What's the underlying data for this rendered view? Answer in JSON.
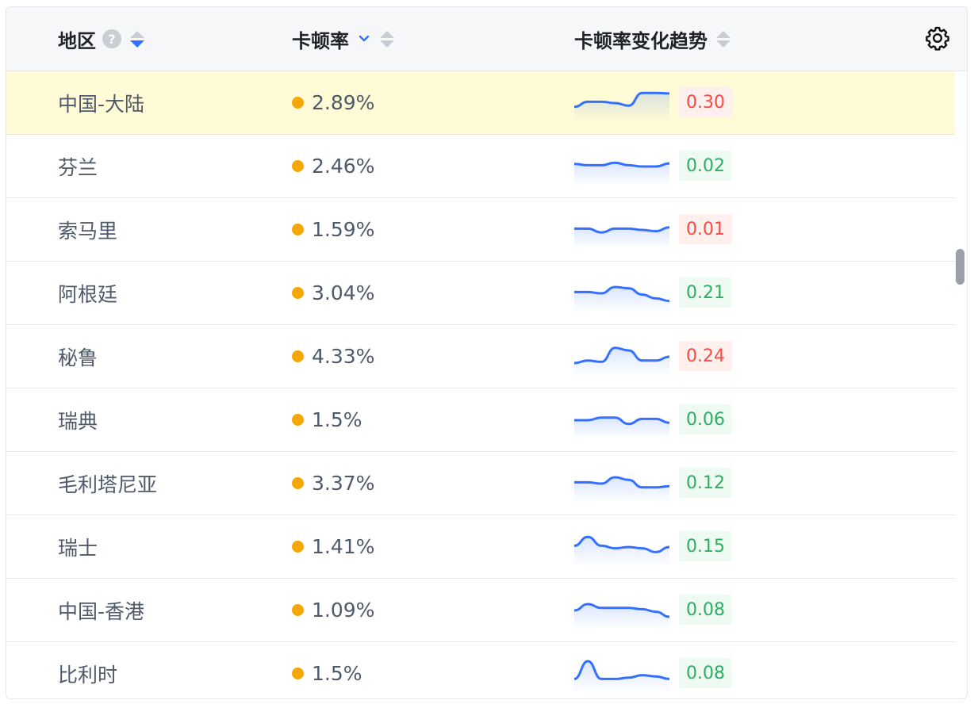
{
  "header": {
    "region_label": "地区",
    "help_glyph": "?",
    "rate_label": "卡顿率",
    "trend_label": "卡顿率变化趋势"
  },
  "colors": {
    "rate_dot": "#f5a70a",
    "spark_line": "#3370ff",
    "up": "#f54a45",
    "down": "#2fae63",
    "highlight_row": "#fffbd6"
  },
  "rows": [
    {
      "region": "中国-大陆",
      "rate": "2.89%",
      "delta": "0.30",
      "direction": "up",
      "highlighted": true,
      "trend": [
        0.35,
        0.55,
        0.55,
        0.5,
        0.4,
        0.9,
        0.9,
        0.88
      ]
    },
    {
      "region": "芬兰",
      "rate": "2.46%",
      "delta": "0.02",
      "direction": "down",
      "highlighted": false,
      "trend": [
        0.6,
        0.55,
        0.55,
        0.65,
        0.55,
        0.5,
        0.5,
        0.62
      ]
    },
    {
      "region": "索马里",
      "rate": "1.59%",
      "delta": "0.01",
      "direction": "up",
      "highlighted": false,
      "trend": [
        0.55,
        0.55,
        0.4,
        0.55,
        0.55,
        0.5,
        0.45,
        0.6
      ]
    },
    {
      "region": "阿根廷",
      "rate": "3.04%",
      "delta": "0.21",
      "direction": "down",
      "highlighted": false,
      "trend": [
        0.55,
        0.55,
        0.5,
        0.75,
        0.7,
        0.45,
        0.3,
        0.2
      ]
    },
    {
      "region": "秘鲁",
      "rate": "4.33%",
      "delta": "0.24",
      "direction": "up",
      "highlighted": false,
      "trend": [
        0.25,
        0.35,
        0.3,
        0.85,
        0.75,
        0.35,
        0.35,
        0.5
      ]
    },
    {
      "region": "瑞典",
      "rate": "1.5%",
      "delta": "0.06",
      "direction": "down",
      "highlighted": false,
      "trend": [
        0.5,
        0.5,
        0.6,
        0.6,
        0.35,
        0.55,
        0.55,
        0.4
      ]
    },
    {
      "region": "毛利塔尼亚",
      "rate": "3.37%",
      "delta": "0.12",
      "direction": "down",
      "highlighted": false,
      "trend": [
        0.55,
        0.55,
        0.5,
        0.75,
        0.65,
        0.35,
        0.35,
        0.4
      ]
    },
    {
      "region": "瑞士",
      "rate": "1.41%",
      "delta": "0.15",
      "direction": "down",
      "highlighted": false,
      "trend": [
        0.55,
        0.9,
        0.55,
        0.45,
        0.5,
        0.45,
        0.3,
        0.5
      ]
    },
    {
      "region": "中国-香港",
      "rate": "1.09%",
      "delta": "0.08",
      "direction": "down",
      "highlighted": false,
      "trend": [
        0.5,
        0.75,
        0.6,
        0.6,
        0.6,
        0.55,
        0.45,
        0.25
      ]
    },
    {
      "region": "比利时",
      "rate": "1.5%",
      "delta": "0.08",
      "direction": "down",
      "highlighted": false,
      "trend": [
        0.3,
        1.0,
        0.3,
        0.3,
        0.35,
        0.45,
        0.4,
        0.3
      ]
    }
  ]
}
